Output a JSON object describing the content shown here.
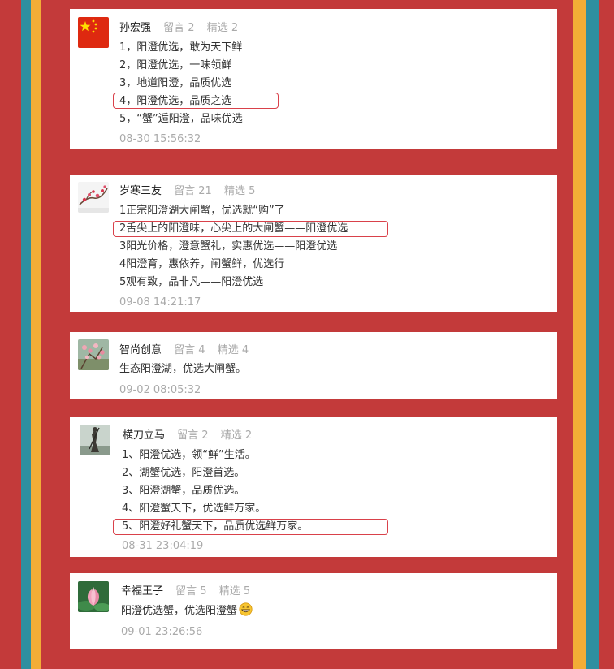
{
  "labels": {
    "comment_prefix": "留言",
    "selected_prefix": "精选"
  },
  "colors": {
    "background": "#c33a3a",
    "teal": "#2e8fa0",
    "gold": "#f2ad36",
    "highlight": "#d9414a"
  },
  "comments": [
    {
      "avatar": "chinese-flag-icon",
      "name": "孙宏强",
      "stats": {
        "comments": "留言 2",
        "selected": "精选 2"
      },
      "lines": [
        "1，阳澄优选，敢为天下鲜",
        "2，阳澄优选，一味领鲜",
        "3，地道阳澄，品质优选",
        "4，阳澄优选，品质之选",
        "5，“蟹”逅阳澄，品味优选"
      ],
      "highlighted_line": 3,
      "time": "08-30 15:56:32"
    },
    {
      "avatar": "plum-blossom-icon",
      "name": "岁寒三友",
      "stats": {
        "comments": "留言 21",
        "selected": "精选 5"
      },
      "lines": [
        "1正宗阳澄湖大闸蟹，优选就“购”了",
        "2舌尖上的阳澄味，心尖上的大闸蟹——阳澄优选",
        "3阳光价格，澄意蟹礼，实惠优选——阳澄优选",
        "4阳澄育，惠依养，闸蟹鲜，优选行",
        "5观有致，品非凡——阳澄优选"
      ],
      "highlighted_line": 1,
      "time": "09-08 14:21:17"
    },
    {
      "avatar": "peach-blossom-icon",
      "name": "智尚创意",
      "stats": {
        "comments": "留言 4",
        "selected": "精选 4"
      },
      "lines": [
        "生态阳澄湖，优选大闸蟹。"
      ],
      "time": "09-02 08:05:32"
    },
    {
      "avatar": "warrior-figure-icon",
      "name": "横刀立马",
      "stats": {
        "comments": "留言 2",
        "selected": "精选 2"
      },
      "lines": [
        "1、阳澄优选，领“鲜”生活。",
        "2、湖蟹优选，阳澄首选。",
        "3、阳澄湖蟹，品质优选。",
        "4、阳澄蟹天下，优选鲜万家。",
        "5、阳澄好礼蟹天下，品质优选鲜万家。"
      ],
      "highlighted_line": 4,
      "time": "08-31 23:04:19"
    },
    {
      "avatar": "lotus-flower-icon",
      "name": "幸福王子",
      "stats": {
        "comments": "留言 5",
        "selected": "精选 5"
      },
      "lines": [
        "阳澄优选蟹，优选阳澄蟹"
      ],
      "emoji": "grinning-face-icon",
      "time": "09-01 23:26:56"
    }
  ]
}
